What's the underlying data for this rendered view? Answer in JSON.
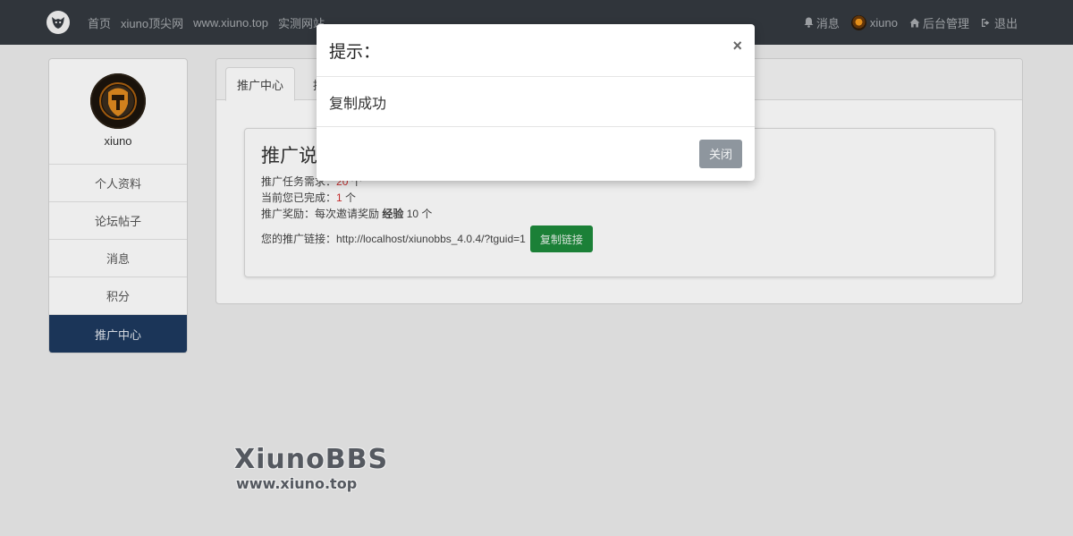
{
  "navbar": {
    "logo_icon": "fox-logo-icon",
    "links": [
      {
        "label": "首页"
      },
      {
        "label": "xiuno顶尖网"
      },
      {
        "label": "www.xiuno.top"
      },
      {
        "label": "实测网站"
      }
    ],
    "right": {
      "messages_label": "消息",
      "user_label": "xiuno",
      "admin_label": "后台管理",
      "logout_label": "退出"
    }
  },
  "sidebar": {
    "username": "xiuno",
    "items": [
      {
        "label": "个人资料"
      },
      {
        "label": "论坛帖子"
      },
      {
        "label": "消息"
      },
      {
        "label": "积分"
      },
      {
        "label": "推广中心",
        "active": true
      }
    ]
  },
  "main": {
    "tabs": [
      {
        "label": "推广中心"
      },
      {
        "label": "推"
      }
    ],
    "panel": {
      "title": "推广说",
      "task_label": "推广任务需求：",
      "task_value": "20",
      "task_unit": " 个",
      "done_label": "当前您已完成：",
      "done_value": "1",
      "done_unit": " 个",
      "reward_label": "推广奖励：每次邀请奖励 ",
      "reward_bold": "经验",
      "reward_value": " 10 个",
      "link_label": "您的推广链接：http://localhost/xiunobbs_4.0.4/?tguid=1",
      "copy_button": "复制链接"
    }
  },
  "watermark": {
    "title": "XiunoBBS",
    "subtitle": "www.xiuno.top"
  },
  "modal": {
    "title": "提示：",
    "close_symbol": "×",
    "message": "复制成功",
    "close_button": "关闭"
  },
  "colors": {
    "navbar": "#343a40",
    "sidebar_active": "#1e3a5f",
    "copy_button": "#1e8a3c",
    "close_button": "#8e969e",
    "highlight_red": "#d32f2f"
  }
}
